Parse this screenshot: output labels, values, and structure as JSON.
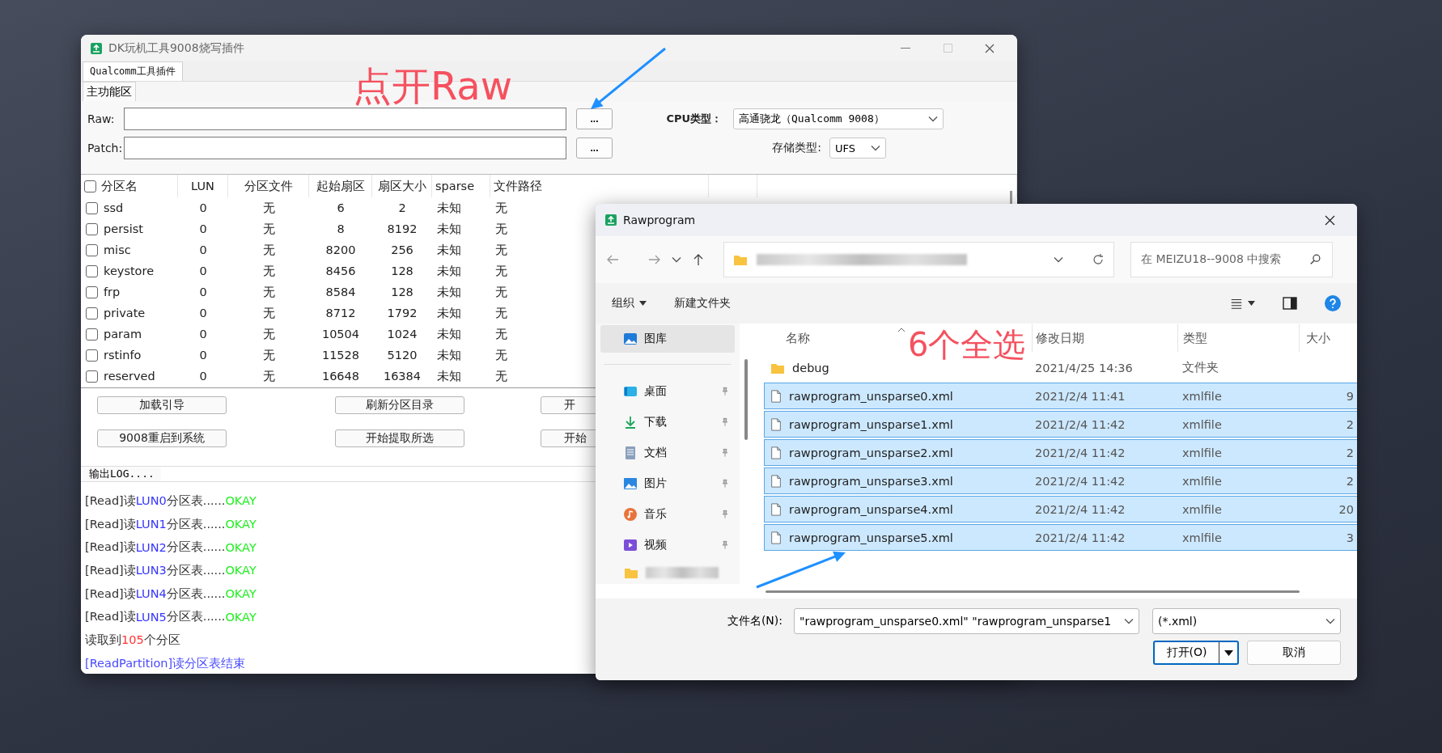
{
  "main_window": {
    "title": "DK玩机工具9008烧写插件",
    "tabs": [
      {
        "label": "Qualcomm工具插件",
        "selected": true
      }
    ],
    "section_tabs": [
      {
        "label": "主功能区",
        "selected": true
      }
    ],
    "raw": {
      "label": "Raw:",
      "browse": "..."
    },
    "patch": {
      "label": "Patch:",
      "browse": "..."
    },
    "cpu_type": {
      "label": "CPU类型：",
      "value": "高通骁龙（Qualcomm 9008）"
    },
    "storage_type": {
      "label": "存储类型:",
      "value": "UFS"
    },
    "table": {
      "select_all": false,
      "columns": [
        "分区名",
        "LUN",
        "分区文件",
        "起始扇区",
        "扇区大小",
        "sparse",
        "文件路径"
      ],
      "rows": [
        {
          "checked": false,
          "cells": [
            "ssd",
            "0",
            "无",
            "6",
            "2",
            "未知",
            "无"
          ]
        },
        {
          "checked": false,
          "cells": [
            "persist",
            "0",
            "无",
            "8",
            "8192",
            "未知",
            "无"
          ]
        },
        {
          "checked": false,
          "cells": [
            "misc",
            "0",
            "无",
            "8200",
            "256",
            "未知",
            "无"
          ]
        },
        {
          "checked": false,
          "cells": [
            "keystore",
            "0",
            "无",
            "8456",
            "128",
            "未知",
            "无"
          ]
        },
        {
          "checked": false,
          "cells": [
            "frp",
            "0",
            "无",
            "8584",
            "128",
            "未知",
            "无"
          ]
        },
        {
          "checked": false,
          "cells": [
            "private",
            "0",
            "无",
            "8712",
            "1792",
            "未知",
            "无"
          ]
        },
        {
          "checked": false,
          "cells": [
            "param",
            "0",
            "无",
            "10504",
            "1024",
            "未知",
            "无"
          ]
        },
        {
          "checked": false,
          "cells": [
            "rstinfo",
            "0",
            "无",
            "11528",
            "5120",
            "未知",
            "无"
          ]
        },
        {
          "checked": false,
          "cells": [
            "reserved",
            "0",
            "无",
            "16648",
            "16384",
            "未知",
            "无"
          ]
        }
      ]
    },
    "button_rows": [
      [
        "加载引导",
        "刷新分区目录",
        "开"
      ],
      [
        "9008重启到系统",
        "开始提取所选",
        "开始"
      ]
    ],
    "log": {
      "label": "输出LOG....",
      "lines": [
        [
          {
            "text": "[Read]读",
            "color": "#333333"
          },
          {
            "text": "LUN0",
            "color": "#3535ff"
          },
          {
            "text": "分区表......",
            "color": "#333333"
          },
          {
            "text": "OKAY",
            "color": "#22ee22"
          }
        ],
        [
          {
            "text": "[Read]读",
            "color": "#333333"
          },
          {
            "text": "LUN1",
            "color": "#3535ff"
          },
          {
            "text": "分区表......",
            "color": "#333333"
          },
          {
            "text": "OKAY",
            "color": "#22ee22"
          }
        ],
        [
          {
            "text": "[Read]读",
            "color": "#333333"
          },
          {
            "text": "LUN2",
            "color": "#3535ff"
          },
          {
            "text": "分区表......",
            "color": "#333333"
          },
          {
            "text": "OKAY",
            "color": "#22ee22"
          }
        ],
        [
          {
            "text": "[Read]读",
            "color": "#333333"
          },
          {
            "text": "LUN3",
            "color": "#3535ff"
          },
          {
            "text": "分区表......",
            "color": "#333333"
          },
          {
            "text": "OKAY",
            "color": "#22ee22"
          }
        ],
        [
          {
            "text": "[Read]读",
            "color": "#333333"
          },
          {
            "text": "LUN4",
            "color": "#3535ff"
          },
          {
            "text": "分区表......",
            "color": "#333333"
          },
          {
            "text": "OKAY",
            "color": "#22ee22"
          }
        ],
        [
          {
            "text": "[Read]读",
            "color": "#333333"
          },
          {
            "text": "LUN5",
            "color": "#3535ff"
          },
          {
            "text": "分区表......",
            "color": "#333333"
          },
          {
            "text": "OKAY",
            "color": "#22ee22"
          }
        ],
        [
          {
            "text": "读取到",
            "color": "#333333"
          },
          {
            "text": "105",
            "color": "#ff3333"
          },
          {
            "text": "个分区",
            "color": "#333333"
          }
        ],
        [
          {
            "text": "[ReadPartition]读分区表结束",
            "color": "#4a4aff"
          }
        ]
      ]
    }
  },
  "dialog": {
    "title": "Rawprogram",
    "search": {
      "placeholder": "在 MEIZU18--9008 中搜索"
    },
    "toolbar": {
      "organize": "组织",
      "new_folder": "新建文件夹"
    },
    "nav_items": [
      {
        "label": "图库",
        "selected": true,
        "pinned": false
      },
      {
        "label": "桌面",
        "selected": false,
        "pinned": true
      },
      {
        "label": "下载",
        "selected": false,
        "pinned": true
      },
      {
        "label": "文档",
        "selected": false,
        "pinned": true
      },
      {
        "label": "图片",
        "selected": false,
        "pinned": true
      },
      {
        "label": "音乐",
        "selected": false,
        "pinned": true
      },
      {
        "label": "视频",
        "selected": false,
        "pinned": true
      }
    ],
    "columns": [
      "名称",
      "修改日期",
      "类型",
      "大小"
    ],
    "files": [
      {
        "kind": "folder",
        "name": "debug",
        "date": "2021/4/25 14:36",
        "type": "文件夹",
        "selected": false
      },
      {
        "kind": "file",
        "name": "rawprogram_unsparse0.xml",
        "date": "2021/2/4 11:41",
        "type": "xmlfile",
        "size": "9",
        "selected": true
      },
      {
        "kind": "file",
        "name": "rawprogram_unsparse1.xml",
        "date": "2021/2/4 11:42",
        "type": "xmlfile",
        "size": "2",
        "selected": true
      },
      {
        "kind": "file",
        "name": "rawprogram_unsparse2.xml",
        "date": "2021/2/4 11:42",
        "type": "xmlfile",
        "size": "2",
        "selected": true
      },
      {
        "kind": "file",
        "name": "rawprogram_unsparse3.xml",
        "date": "2021/2/4 11:42",
        "type": "xmlfile",
        "size": "2",
        "selected": true
      },
      {
        "kind": "file",
        "name": "rawprogram_unsparse4.xml",
        "date": "2021/2/4 11:42",
        "type": "xmlfile",
        "size": "20",
        "selected": true
      },
      {
        "kind": "file",
        "name": "rawprogram_unsparse5.xml",
        "date": "2021/2/4 11:42",
        "type": "xmlfile",
        "size": "3",
        "selected": true
      }
    ],
    "file_name": {
      "label": "文件名(N):",
      "value": "\"rawprogram_unsparse0.xml\" \"rawprogram_unsparse1"
    },
    "file_type": {
      "value": "(*.xml)"
    },
    "open_button": "打开(O)",
    "cancel_button": "取消"
  },
  "annotations": [
    {
      "text": "点开Raw"
    },
    {
      "text": "6个全选"
    }
  ]
}
